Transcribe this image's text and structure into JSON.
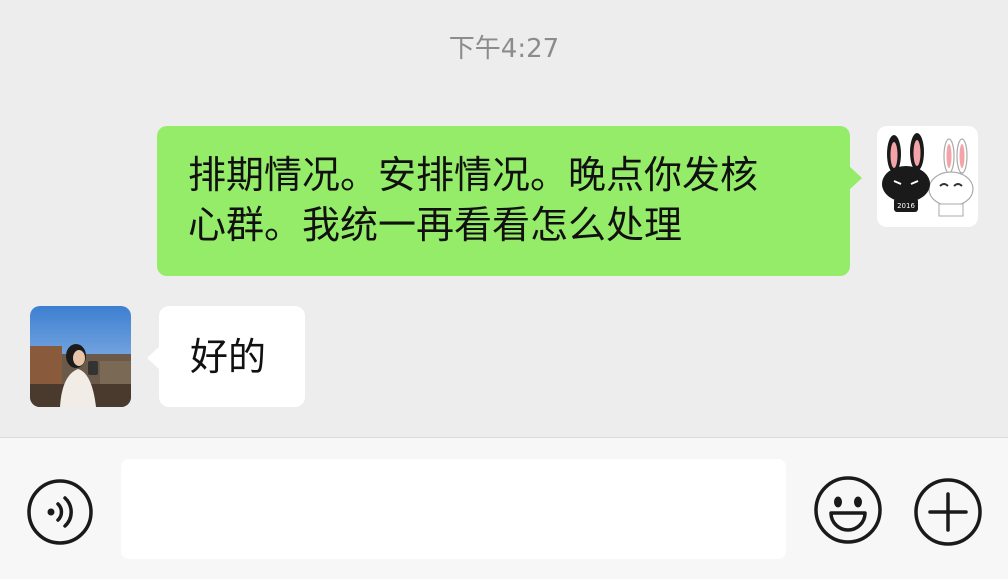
{
  "chat": {
    "timestamp": "下午4:27",
    "messages": [
      {
        "direction": "outgoing",
        "lines": [
          "排期情况。安排情况。晚点你发核",
          "心群。我统一再看看怎么处理"
        ],
        "bubble_color": "#95ec69",
        "avatar": "rabbit-sticker-avatar",
        "avatar_text": "2016"
      },
      {
        "direction": "incoming",
        "lines": [
          "好的"
        ],
        "bubble_color": "#ffffff",
        "avatar": "contact-photo-avatar"
      }
    ]
  },
  "input_bar": {
    "voice_icon": "voice-wave-icon",
    "text_value": "",
    "emoji_icon": "smiley-face-icon",
    "more_icon": "plus-circle-icon"
  },
  "colors": {
    "background": "#ededed",
    "outgoing_bubble": "#95ec69",
    "incoming_bubble": "#ffffff",
    "input_bar": "#f7f7f7"
  }
}
